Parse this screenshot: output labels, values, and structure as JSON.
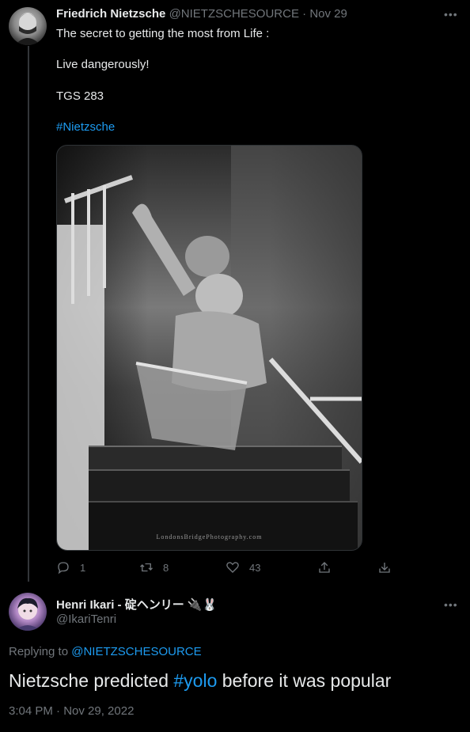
{
  "tweet1": {
    "author_name": "Friedrich Nietzsche",
    "handle": "@NIETZSCHESOURCE",
    "separator": "·",
    "date": "Nov 29",
    "lines": [
      "The secret to getting the most from Life :",
      "Live dangerously!",
      "TGS 283"
    ],
    "hashtag": "#Nietzsche",
    "media_watermark": "LondonsBridgePhotography.com",
    "actions": {
      "reply_count": "1",
      "retweet_count": "8",
      "like_count": "43"
    }
  },
  "tweet2": {
    "author_name": "Henri Ikari - 碇ヘンリー 🔌🐰",
    "handle": "@IkariTenri",
    "replying_prefix": "Replying to",
    "replying_to": "@NIETZSCHESOURCE",
    "text_before": "Nietzsche predicted",
    "hashtag": "#yolo",
    "text_after": "before it was popular",
    "timestamp": "3:04 PM · Nov 29, 2022"
  },
  "icons": {
    "more": "more-dots-icon",
    "reply": "reply-icon",
    "retweet": "retweet-icon",
    "like": "heart-icon",
    "share": "share-icon",
    "bookmark": "download-icon"
  },
  "colors": {
    "background": "#000000",
    "text": "#e7e9ea",
    "muted": "#71767b",
    "accent": "#1d9bf0"
  }
}
